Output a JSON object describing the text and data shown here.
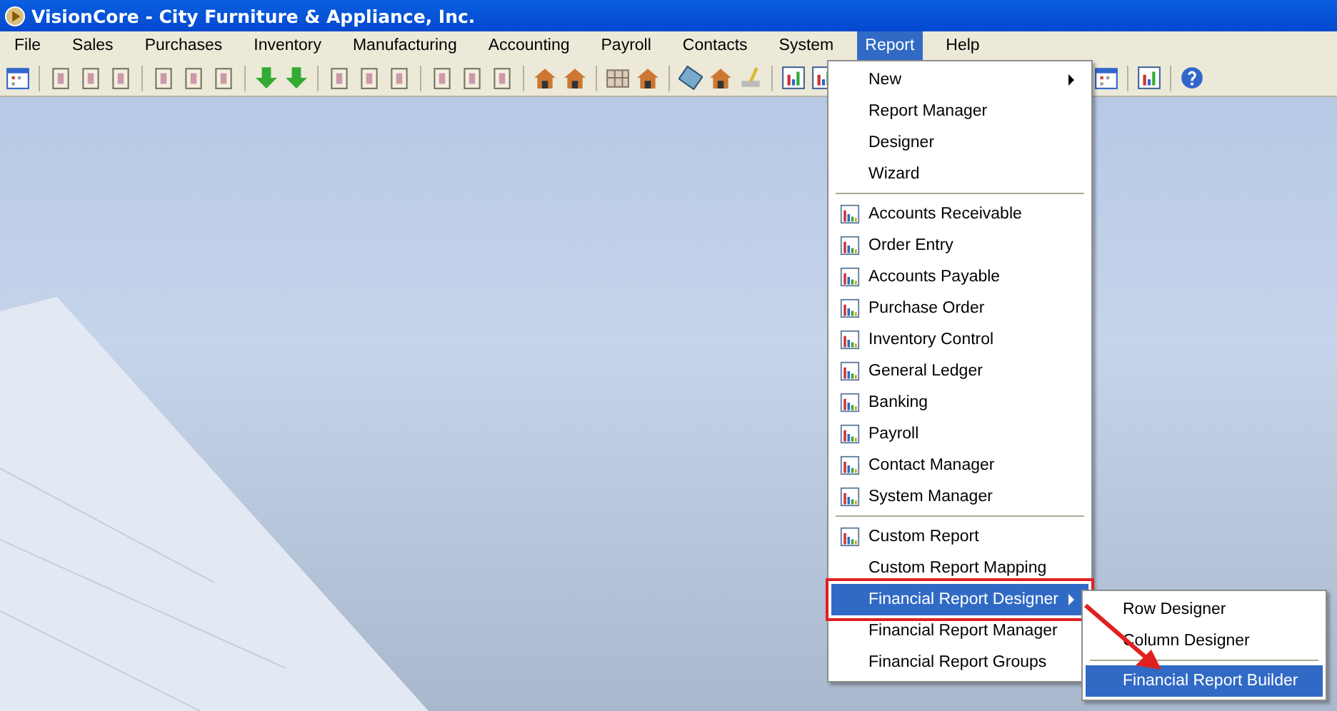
{
  "window": {
    "title": "VisionCore - City Furniture & Appliance, Inc."
  },
  "menubar": [
    {
      "label": "File",
      "selected": false
    },
    {
      "label": "Sales",
      "selected": false
    },
    {
      "label": "Purchases",
      "selected": false
    },
    {
      "label": "Inventory",
      "selected": false
    },
    {
      "label": "Manufacturing",
      "selected": false
    },
    {
      "label": "Accounting",
      "selected": false
    },
    {
      "label": "Payroll",
      "selected": false
    },
    {
      "label": "Contacts",
      "selected": false
    },
    {
      "label": "System",
      "selected": false
    },
    {
      "label": "Report",
      "selected": true
    },
    {
      "label": "Help",
      "selected": false
    }
  ],
  "report_menu": [
    {
      "kind": "item",
      "label": "New",
      "submenu": true,
      "icon": false,
      "selected": false
    },
    {
      "kind": "item",
      "label": "Report Manager",
      "submenu": false,
      "icon": false,
      "selected": false
    },
    {
      "kind": "item",
      "label": "Designer",
      "submenu": false,
      "icon": false,
      "selected": false
    },
    {
      "kind": "item",
      "label": "Wizard",
      "submenu": false,
      "icon": false,
      "selected": false
    },
    {
      "kind": "separator"
    },
    {
      "kind": "item",
      "label": "Accounts Receivable",
      "submenu": false,
      "icon": true,
      "selected": false
    },
    {
      "kind": "item",
      "label": "Order Entry",
      "submenu": false,
      "icon": true,
      "selected": false
    },
    {
      "kind": "item",
      "label": "Accounts Payable",
      "submenu": false,
      "icon": true,
      "selected": false
    },
    {
      "kind": "item",
      "label": "Purchase Order",
      "submenu": false,
      "icon": true,
      "selected": false
    },
    {
      "kind": "item",
      "label": "Inventory Control",
      "submenu": false,
      "icon": true,
      "selected": false
    },
    {
      "kind": "item",
      "label": "General Ledger",
      "submenu": false,
      "icon": true,
      "selected": false
    },
    {
      "kind": "item",
      "label": "Banking",
      "submenu": false,
      "icon": true,
      "selected": false
    },
    {
      "kind": "item",
      "label": "Payroll",
      "submenu": false,
      "icon": true,
      "selected": false
    },
    {
      "kind": "item",
      "label": "Contact Manager",
      "submenu": false,
      "icon": true,
      "selected": false
    },
    {
      "kind": "item",
      "label": "System Manager",
      "submenu": false,
      "icon": true,
      "selected": false
    },
    {
      "kind": "separator"
    },
    {
      "kind": "item",
      "label": "Custom Report",
      "submenu": false,
      "icon": true,
      "selected": false
    },
    {
      "kind": "item",
      "label": "Custom Report Mapping",
      "submenu": false,
      "icon": false,
      "selected": false
    },
    {
      "kind": "item",
      "label": "Financial Report Designer",
      "submenu": true,
      "icon": false,
      "selected": true
    },
    {
      "kind": "item",
      "label": "Financial Report Manager",
      "submenu": false,
      "icon": false,
      "selected": false
    },
    {
      "kind": "item",
      "label": "Financial Report Groups",
      "submenu": false,
      "icon": false,
      "selected": false
    }
  ],
  "financial_submenu": [
    {
      "kind": "item",
      "label": "Row Designer",
      "selected": false
    },
    {
      "kind": "item",
      "label": "Column Designer",
      "selected": false
    },
    {
      "kind": "separator"
    },
    {
      "kind": "item",
      "label": "Financial Report Builder",
      "selected": true
    }
  ]
}
